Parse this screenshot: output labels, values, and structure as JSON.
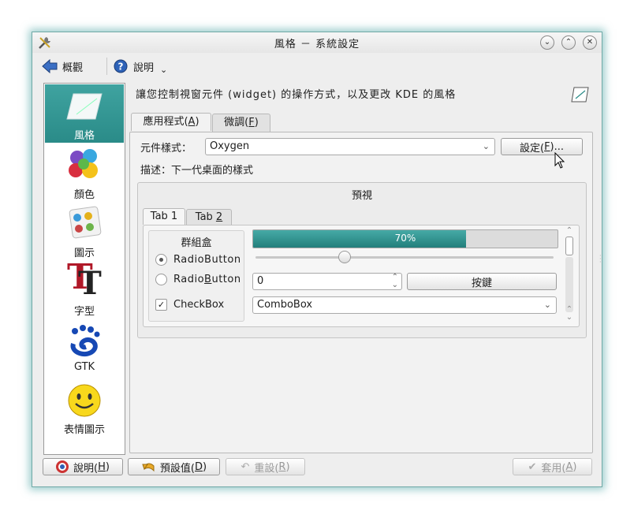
{
  "window": {
    "title": "風格 － 系統設定",
    "controls": {
      "minimize": "⌄",
      "maximize": "⌃",
      "close": "✕"
    }
  },
  "toolbar": {
    "overview_label": "概觀",
    "help_label": "說明",
    "help_arrow": "⌄"
  },
  "sidebar": {
    "items": [
      {
        "label": "風格",
        "icon": "style-icon",
        "selected": true
      },
      {
        "label": "顏色",
        "icon": "colors-icon"
      },
      {
        "label": "圖示",
        "icon": "icons-icon"
      },
      {
        "label": "字型",
        "icon": "fonts-icon"
      },
      {
        "label": "GTK",
        "icon": "gtk-icon"
      },
      {
        "label": "表情圖示",
        "icon": "emoticons-icon"
      }
    ]
  },
  "main": {
    "header": "讓您控制視窗元件 (widget) 的操作方式，以及更改 KDE 的風格",
    "tabs": [
      {
        "label": "應用程式(",
        "mnemonic": "A",
        "suffix": ")",
        "active": true
      },
      {
        "label": "微調(",
        "mnemonic": "F",
        "suffix": ")",
        "active": false
      }
    ],
    "widget_style_label": "元件樣式：",
    "widget_style_value": "Oxygen",
    "configure_label": "設定(",
    "configure_mnemonic": "F",
    "configure_suffix": ")...",
    "description": "描述：下一代桌面的樣式",
    "preview": {
      "title": "預視",
      "tabs": [
        {
          "label": "Tab 1"
        },
        {
          "label": "Tab ",
          "mnemonic": "2"
        }
      ],
      "groupbox_title": "群組盒",
      "radio1_label": "RadioButton",
      "radio2_pre": "Radio",
      "radio2_mnemonic": "B",
      "radio2_post": "utton",
      "checkbox_label": "CheckBox",
      "progress": {
        "value": 0.7,
        "text": "70%"
      },
      "slider_value": 0.3,
      "spinbox_value": "0",
      "push_button_label": "按鍵",
      "combobox_value": "ComboBox"
    }
  },
  "bottom": {
    "help": {
      "pre": "說明(",
      "m": "H",
      "post": ")"
    },
    "defaults": {
      "pre": "預設值(",
      "m": "D",
      "post": ")"
    },
    "reset": {
      "pre": "重設(",
      "m": "R",
      "post": ")"
    },
    "apply": {
      "pre": "套用(",
      "m": "A",
      "post": ")"
    }
  },
  "colors": {
    "accent": "#2a8b88",
    "progress": "#2f9490"
  }
}
